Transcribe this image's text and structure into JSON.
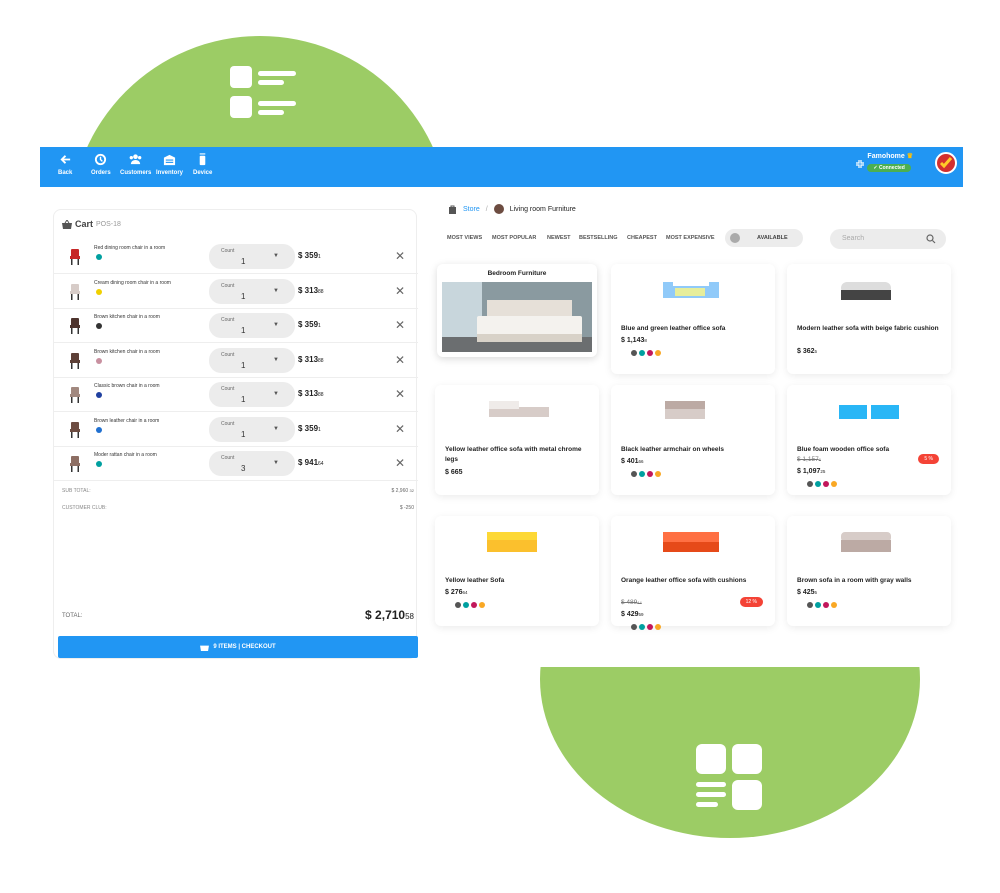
{
  "nav": {
    "back": "Back",
    "orders": "Orders",
    "customers": "Customers",
    "inventory": "Inventory",
    "device": "Device"
  },
  "user": {
    "name": "Famohome",
    "status": "Connected"
  },
  "cart": {
    "title": "Cart",
    "pos": "POS-18",
    "count_label": "Count",
    "items": [
      {
        "name": "Red dining room chair in a room",
        "count": "1",
        "price": "$ 359",
        "cents": "1",
        "dot": "#00a0a0"
      },
      {
        "name": "Cream dining room chair in a room",
        "count": "1",
        "price": "$ 313",
        "cents": "88",
        "dot": "#f0d000"
      },
      {
        "name": "Brown kitchen chair in a room",
        "count": "1",
        "price": "$ 359",
        "cents": "1",
        "dot": "#333333"
      },
      {
        "name": "Brown kitchen chair in a room",
        "count": "1",
        "price": "$ 313",
        "cents": "88",
        "dot": "#c890a0"
      },
      {
        "name": "Classic brown chair in a room",
        "count": "1",
        "price": "$ 313",
        "cents": "88",
        "dot": "#2040a0"
      },
      {
        "name": "Brown leather chair in a room",
        "count": "1",
        "price": "$ 359",
        "cents": "1",
        "dot": "#2070d0"
      },
      {
        "name": "Moder rattan chair in a room",
        "count": "3",
        "price": "$ 941",
        "cents": "64",
        "dot": "#00a0a0"
      }
    ],
    "subtotal_label": "SUB TOTAL:",
    "subtotal": "$ 2,960",
    "subtotal_cents": "32",
    "club_label": "CUSTOMER CLUB:",
    "club": "$ -250",
    "total_label": "TOTAL:",
    "total": "$ 2,710",
    "total_cents": "58",
    "checkout": "9 ITEMS | CHECKOUT"
  },
  "breadcrumb": {
    "store": "Store",
    "separator": "/",
    "category": "Living room Furniture"
  },
  "filters": [
    "MOST VIEWS",
    "MOST POPULAR",
    "NEWEST",
    "BESTSELLING",
    "CHEAPEST",
    "MOST EXPENSIVE"
  ],
  "available_label": "AVAILABLE",
  "search_placeholder": "Search",
  "feature_title": "Bedroom Furniture",
  "products": [
    {
      "title": "Blue and green leather office sofa",
      "price": "$ 1,143",
      "cents": "8",
      "dots": [
        "#555555",
        "#00a0a0",
        "#c2185b",
        "#f9a825"
      ]
    },
    {
      "title": "Modern leather sofa with beige fabric cushion",
      "price": "$ 362",
      "cents": "5",
      "dots": []
    },
    {
      "title": "Yellow leather office sofa with metal chrome legs",
      "price": "$ 665",
      "cents": "",
      "dots": []
    },
    {
      "title": "Black leather armchair on wheels",
      "price": "$ 401",
      "cents": "66",
      "dots": [
        "#555555",
        "#00a0a0",
        "#c2185b",
        "#f9a825"
      ]
    },
    {
      "title": "Blue foam wooden office sofa",
      "old": "$ 1,157",
      "old_cents": "6",
      "price": "$ 1,097",
      "cents": "25",
      "badge": "5 %",
      "dots": [
        "#555555",
        "#00a0a0",
        "#c2185b",
        "#f9a825"
      ]
    },
    {
      "title": "Yellow leather Sofa",
      "price": "$ 276",
      "cents": "64",
      "dots": [
        "#555555",
        "#00a0a0",
        "#c2185b",
        "#f9a825"
      ]
    },
    {
      "title": "Orange leather office sofa with cushions",
      "old": "$ 489",
      "old_cents": "44",
      "price": "$ 429",
      "cents": "59",
      "badge": "12 %",
      "dots": [
        "#555555",
        "#00a0a0",
        "#c2185b",
        "#f9a825"
      ]
    },
    {
      "title": "Brown sofa in a room with gray walls",
      "price": "$ 425",
      "cents": "5",
      "dots": [
        "#555555",
        "#00a0a0",
        "#c2185b",
        "#f9a825"
      ]
    }
  ],
  "colors": {
    "accent": "#2196f3",
    "blob": "#9ccc65",
    "badge": "#f44336"
  }
}
